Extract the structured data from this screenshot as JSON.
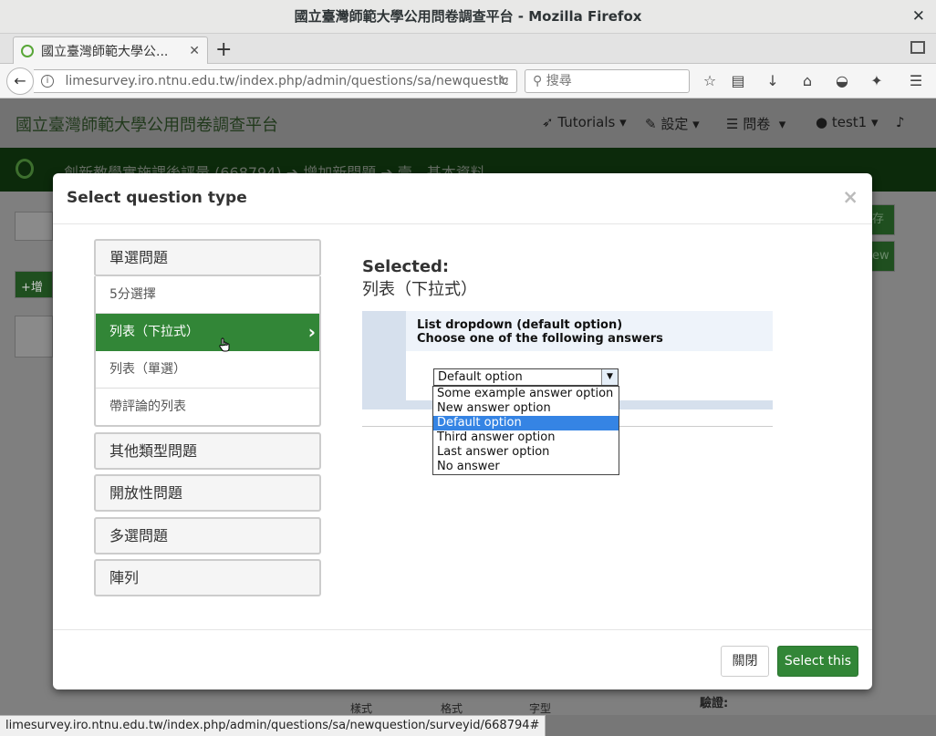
{
  "window": {
    "title": "國立臺灣師範大學公用問卷調查平台 - Mozilla Firefox",
    "tab_title": "國立臺灣師範大學公...",
    "url": "limesurvey.iro.ntnu.edu.tw/index.php/admin/questions/sa/newquestic",
    "search_placeholder": "搜尋",
    "status_url": "limesurvey.iro.ntnu.edu.tw/index.php/admin/questions/sa/newquestion/surveyid/668794#"
  },
  "site": {
    "title": "國立臺灣師範大學公用問卷調查平台",
    "nav": {
      "tutorials": "Tutorials",
      "settings": "設定",
      "surveys": "問卷",
      "user": "test1"
    },
    "breadcrumb": "創新教學實施課後評量 (668794)  ➔  增加新問題  ➔  壹、基本資料"
  },
  "modal": {
    "title": "Select question type",
    "close_symbol": "×",
    "groups": [
      {
        "label": "單選問題"
      },
      {
        "label": "其他類型問題"
      },
      {
        "label": "開放性問題"
      },
      {
        "label": "多選問題"
      },
      {
        "label": "陣列"
      }
    ],
    "items": [
      {
        "label": "5分選擇"
      },
      {
        "label": "列表（下拉式）"
      },
      {
        "label": "列表（單選）"
      },
      {
        "label": "帶評論的列表"
      }
    ],
    "selected_label": "Selected:",
    "selected_value": "列表（下拉式）",
    "preview": {
      "heading": "List dropdown (default option)",
      "question": "Choose one of the following answers",
      "select_value": "Default option",
      "options": [
        "Some example answer option",
        "New answer option",
        "Default option",
        "Third answer option",
        "Last answer option",
        "No answer"
      ],
      "highlighted_index": 2
    },
    "close_button": "關閉",
    "select_button": "Select this"
  },
  "background_fragments": {
    "save_button_fragment": "存",
    "view_button_fragment": "ew",
    "add_fragment": "增",
    "style_label_1": "樣式",
    "style_label_2": "格式",
    "font_label": "字型",
    "validation_label": "驗證:"
  }
}
